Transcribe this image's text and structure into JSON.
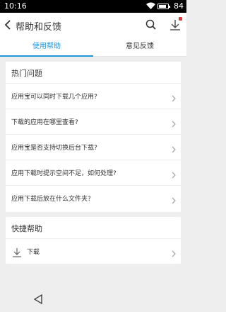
{
  "status_bar": {
    "time": "10:16",
    "battery_text": "84",
    "battery_level": 0.84
  },
  "app_bar": {
    "title": "帮助和反馈"
  },
  "tabs": [
    {
      "label": "使用帮助",
      "active": true
    },
    {
      "label": "意见反馈",
      "active": false
    }
  ],
  "hot_questions": {
    "title": "热门问题",
    "items": [
      "应用宝可以同时下载几个应用?",
      "下载的应用在哪里查看?",
      "应用宝是否支持切换后台下载?",
      "应用下载时提示空间不足，如何处理?",
      "应用下载后放在什么文件夹?"
    ]
  },
  "quick_help": {
    "title": "快捷帮助",
    "items": [
      {
        "label": "下载",
        "icon": "download-icon"
      }
    ]
  },
  "colors": {
    "accent": "#2196d9",
    "badge": "#e53935"
  }
}
